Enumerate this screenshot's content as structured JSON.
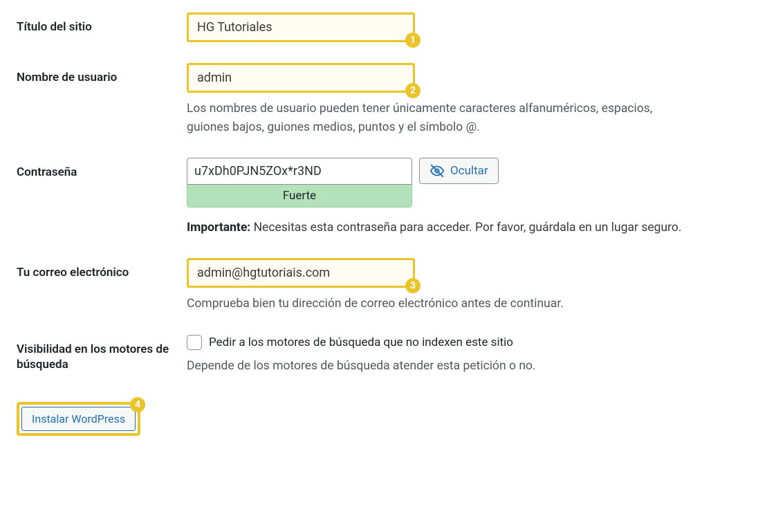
{
  "badges": {
    "b1": "1",
    "b2": "2",
    "b3": "3",
    "b4": "4"
  },
  "site_title": {
    "label": "Título del sitio",
    "value": "HG Tutoriales"
  },
  "username": {
    "label": "Nombre de usuario",
    "value": "admin",
    "desc": "Los nombres de usuario pueden tener únicamente caracteres alfanuméricos, espacios, guiones bajos, guiones medios, puntos y el símbolo @."
  },
  "password": {
    "label": "Contraseña",
    "value": "u7xDh0PJN5ZOx*r3ND",
    "strength": "Fuerte",
    "hide_label": "Ocultar",
    "important_label": "Importante:",
    "important_text": " Necesitas esta contraseña para acceder. Por favor, guárdala en un lugar seguro."
  },
  "email": {
    "label": "Tu correo electrónico",
    "value": "admin@hgtutoriais.com",
    "desc": "Comprueba bien tu dirección de correo electrónico antes de continuar."
  },
  "visibility": {
    "label": "Visibilidad en los motores de búsqueda",
    "checkbox_label": "Pedir a los motores de búsqueda que no indexen este sitio",
    "desc": "Depende de los motores de búsqueda atender esta petición o no."
  },
  "install": {
    "button_label": "Instalar WordPress"
  }
}
